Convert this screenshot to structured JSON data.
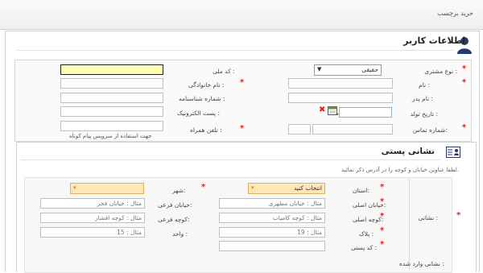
{
  "page": {
    "title": "خرید برچسب"
  },
  "user_section": {
    "title": "اطلاعات کاربر",
    "customer_type": {
      "label": "نوع مشتری :",
      "value": "حقیقی"
    },
    "name": {
      "label": "نام :",
      "value": ""
    },
    "father_name": {
      "label": "نام پدر :",
      "value": ""
    },
    "birth_date": {
      "label": "تاریخ تولد :",
      "value": ""
    },
    "phone": {
      "label": "شماره تماس:",
      "value": ""
    },
    "national_code": {
      "label": "کد ملی :",
      "value": ""
    },
    "family_name": {
      "label": "نام خانوادگی :",
      "value": ""
    },
    "id_number": {
      "label": "شماره شناسنامه :",
      "value": ""
    },
    "email": {
      "label": "پست الکترونیک :",
      "value": ""
    },
    "mobile": {
      "label": "تلفن همراه :",
      "value": "",
      "hint": "جهت استفاده از سرویس پیام کوتاه"
    }
  },
  "postal_section": {
    "title": "نشانی پستی",
    "note": "لطفا عناوین خیابان و کوچه را در آدرس ذکر نمائید.",
    "address_label": "نشانی :",
    "province": {
      "label": "استان:",
      "value": "انتخاب کنید"
    },
    "city": {
      "label": "شهر:",
      "value": ""
    },
    "main_street": {
      "label": "خیابان اصلی:",
      "placeholder": "مثال : خیابان مطهری"
    },
    "side_street": {
      "label": "خیابان فرعی:",
      "placeholder": "مثال : خیابان فجر"
    },
    "main_alley": {
      "label": "کوچه اصلی:",
      "placeholder": "مثال : کوچه کامیاب"
    },
    "side_alley": {
      "label": "کوچه فرعی:",
      "placeholder": "مثال : کوچه افشار"
    },
    "plaque": {
      "label": "پلاک :",
      "placeholder": "مثال : 19"
    },
    "unit": {
      "label": "واحد :",
      "placeholder": "مثال : 15"
    },
    "postal_code": {
      "label": "کد پستی :",
      "value": ""
    },
    "entered_address": {
      "label": "نشانی وارد شده :",
      "value": ""
    }
  },
  "symbols": {
    "required": "*",
    "clear": "✖",
    "dropdown": "▾"
  },
  "colors": {
    "required": "#e02020",
    "focus_field": "#ffffb3",
    "province_select": "#fde6b8"
  }
}
